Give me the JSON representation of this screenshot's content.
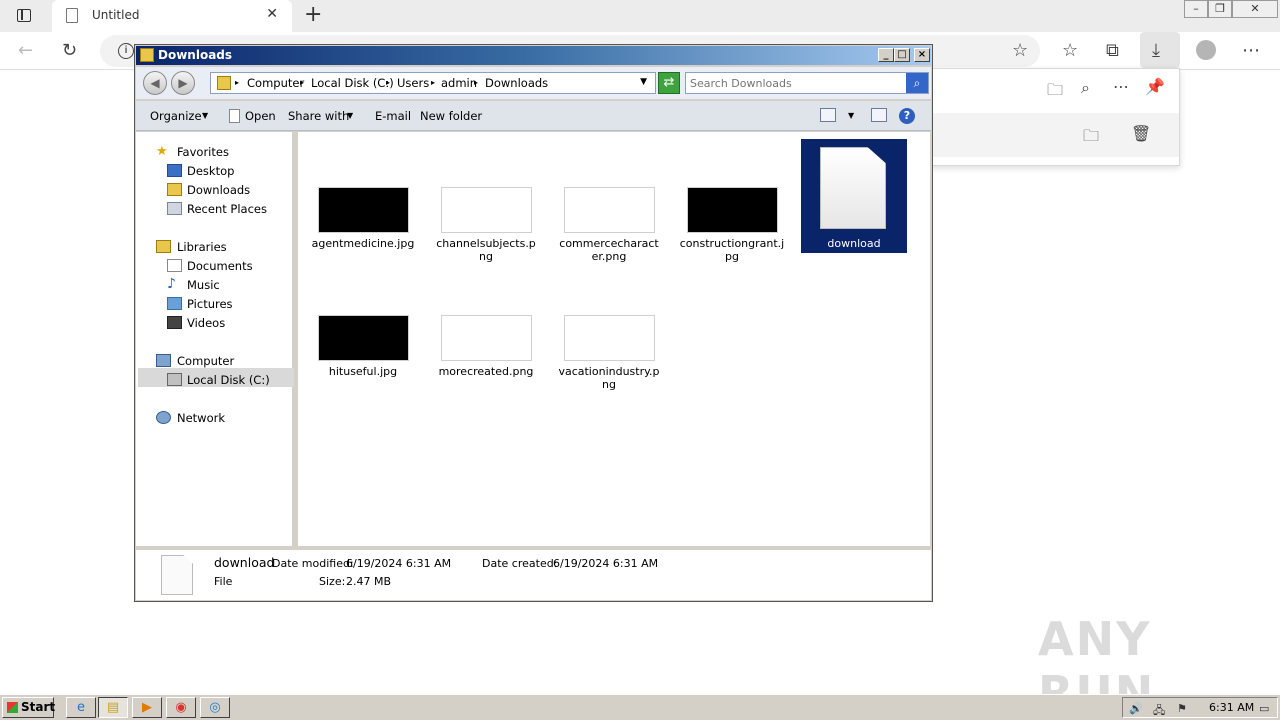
{
  "browser": {
    "tab_title": "Untitled",
    "tab_close": "✕",
    "new_tab": "+",
    "address_info": "i",
    "icons": [
      "tab-actions-icon",
      "back-icon",
      "refresh-icon",
      "add-favorite-icon",
      "favorites-icon",
      "collections-icon",
      "downloads-icon",
      "profile-icon",
      "more-icon"
    ]
  },
  "downloads_panel": {
    "icons": [
      "open-folder-icon",
      "search-icon",
      "more-icon",
      "pin-icon",
      "show-in-folder-icon",
      "delete-icon"
    ]
  },
  "explorer": {
    "title": "Downloads",
    "breadcrumbs": [
      "Computer",
      "Local Disk (C:)",
      "Users",
      "admin",
      "Downloads"
    ],
    "search_placeholder": "Search Downloads",
    "commands": {
      "organize": "Organize",
      "open": "Open",
      "share_with": "Share with",
      "email": "E-mail",
      "new_folder": "New folder"
    },
    "nav": {
      "favorites": "Favorites",
      "desktop": "Desktop",
      "downloads": "Downloads",
      "recent_places": "Recent Places",
      "libraries": "Libraries",
      "documents": "Documents",
      "music": "Music",
      "pictures": "Pictures",
      "videos": "Videos",
      "computer": "Computer",
      "local_disk": "Local Disk (C:)",
      "network": "Network"
    },
    "files": [
      {
        "name": "agentmedicine.jpg",
        "thumb": "black"
      },
      {
        "name": "channelsubjects.png",
        "thumb": "white"
      },
      {
        "name": "commercecharacter.png",
        "thumb": "white"
      },
      {
        "name": "constructiongrant.jpg",
        "thumb": "black"
      },
      {
        "name": "download",
        "thumb": "document",
        "selected": true
      },
      {
        "name": "hituseful.jpg",
        "thumb": "black"
      },
      {
        "name": "morecreated.png",
        "thumb": "white"
      },
      {
        "name": "vacationindustry.png",
        "thumb": "white"
      }
    ],
    "details": {
      "name": "download",
      "modified_label": "Date modified:",
      "modified_value": "6/19/2024 6:31 AM",
      "created_label": "Date created:",
      "created_value": "6/19/2024 6:31 AM",
      "type": "File",
      "size_label": "Size:",
      "size_value": "2.47 MB"
    }
  },
  "watermark": "ANY RUN",
  "taskbar": {
    "start": "Start",
    "clock": "6:31 AM"
  }
}
